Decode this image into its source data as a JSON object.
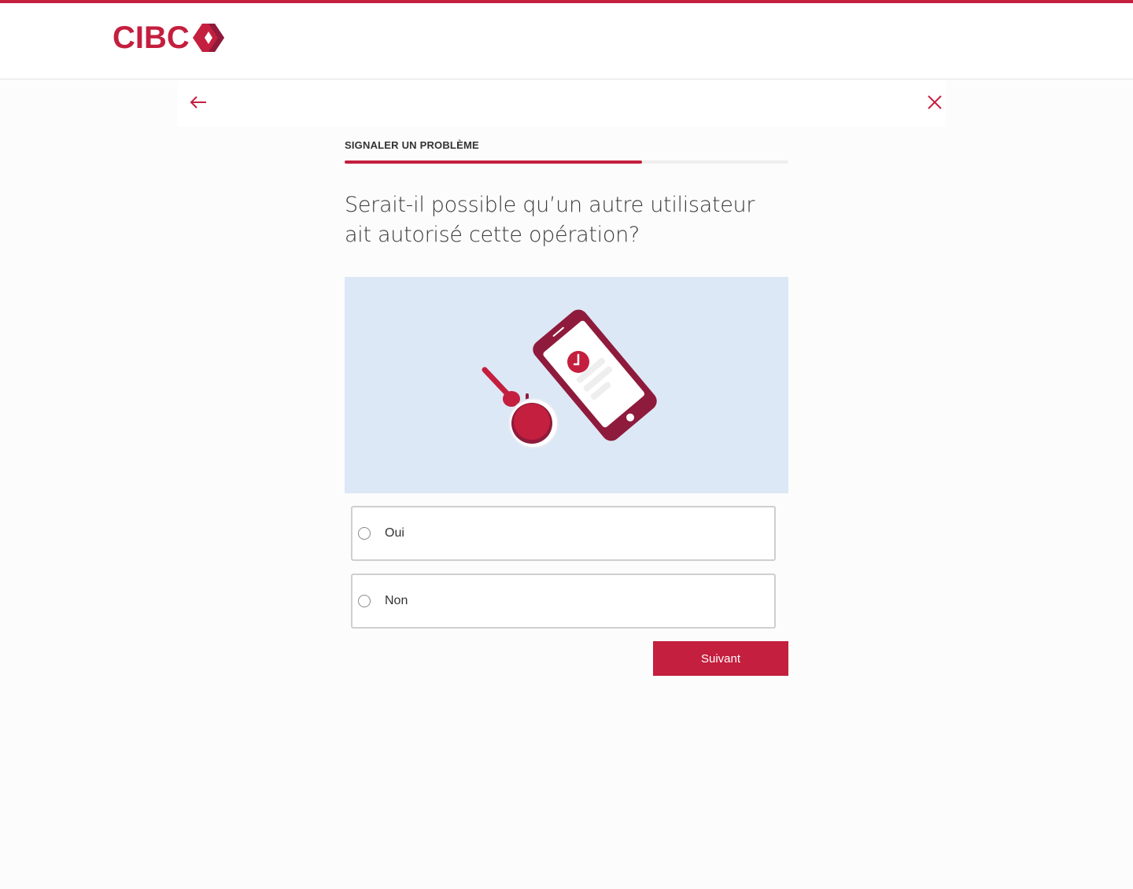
{
  "brand": {
    "logo_text": "CIBC",
    "accent_color": "#c41f3e",
    "accent_dark": "#8f1b3c"
  },
  "nav": {
    "back_icon": "arrow-left-icon",
    "close_icon": "close-icon"
  },
  "flow": {
    "section_label": "SIGNALER UN PROBLÈME",
    "progress_fraction": 0.67
  },
  "question": {
    "text": "Serait-il possible qu’un autre utilisateur ait autorisé cette opération?"
  },
  "illustration": {
    "icon": "phone-and-key-fob-illustration"
  },
  "options": [
    {
      "label": "Oui",
      "selected": false
    },
    {
      "label": "Non",
      "selected": false
    }
  ],
  "actions": {
    "next_label": "Suivant"
  }
}
